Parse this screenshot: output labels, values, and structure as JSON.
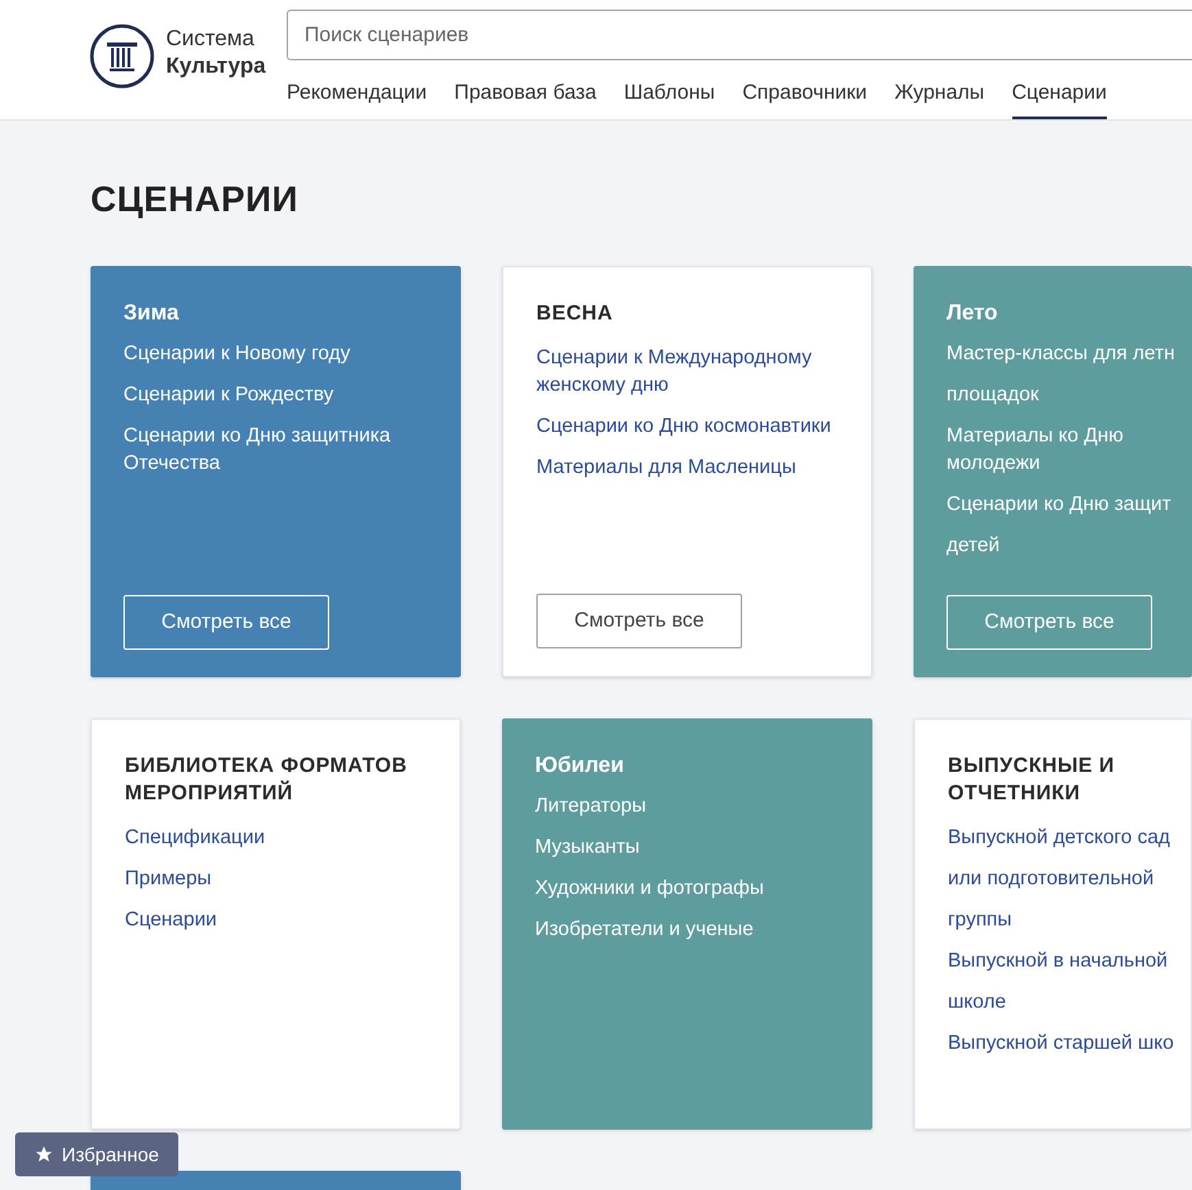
{
  "logo": {
    "line_1": "Система",
    "line_2": "Культура"
  },
  "search": {
    "placeholder": "Поиск сценариев"
  },
  "tabs": [
    {
      "label": "Рекомендации",
      "selected": false
    },
    {
      "label": "Правовая база",
      "selected": false
    },
    {
      "label": "Шаблоны",
      "selected": false
    },
    {
      "label": "Справочники",
      "selected": false
    },
    {
      "label": "Журналы",
      "selected": false
    },
    {
      "label": "Сценарии",
      "selected": true
    }
  ],
  "page_title": "СЦЕНАРИИ",
  "cards": [
    {
      "kind": "filled",
      "color": "#4581b3",
      "title": "Зима",
      "links": [
        "Сценарии к Новому году",
        "Сценарии к Рождеству",
        "Сценарии ко Дню защитника Отечества"
      ],
      "button": "Смотреть все"
    },
    {
      "kind": "plain",
      "title": "ВЕСНА",
      "links": [
        "Сценарии к Международному женскому дню",
        "Сценарии ко Дню космонавтики",
        "Материалы для Масленицы"
      ],
      "button": "Смотреть все"
    },
    {
      "kind": "filled",
      "color": "#5f9c9d",
      "title": "Лето",
      "links": [
        "Мастер-классы для летн",
        "площадок",
        "Материалы ко Дню молодежи",
        "Сценарии ко Дню защит",
        "детей"
      ],
      "button": "Смотреть все"
    },
    {
      "kind": "plain",
      "title": "БИБЛИОТЕКА ФОРМАТОВ МЕРОПРИЯТИЙ",
      "links": [
        "Спецификации",
        "Примеры",
        "Сценарии"
      ]
    },
    {
      "kind": "filled",
      "color": "#5f9c9d",
      "title": "Юбилеи",
      "links": [
        "Литераторы",
        "Музыканты",
        "Художники и фотографы",
        "Изобретатели и ученые"
      ]
    },
    {
      "kind": "plain",
      "title": "ВЫПУСКНЫЕ И ОТЧЕТНИКИ",
      "links": [
        "Выпускной детского сад",
        "или подготовительной",
        "группы",
        "Выпускной в начальной",
        "школе",
        "Выпускной старшей шко"
      ]
    },
    {
      "kind": "filled",
      "color": "#4581b3"
    }
  ],
  "favorites_button": {
    "label": "Избранное"
  }
}
